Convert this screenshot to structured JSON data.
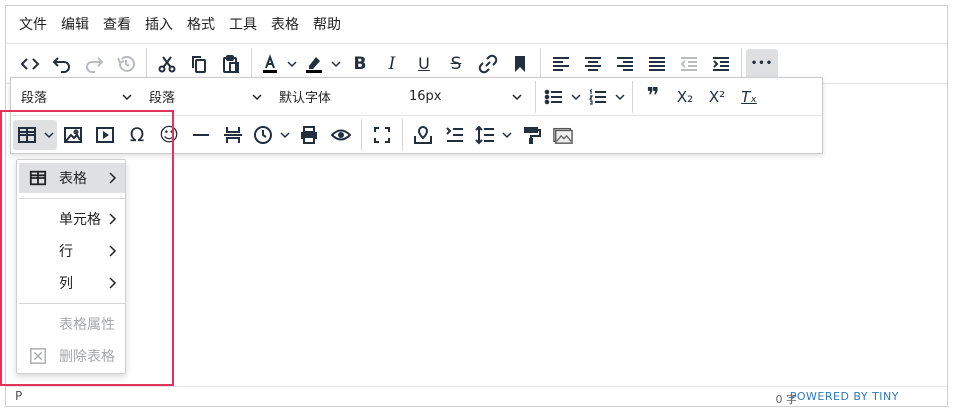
{
  "menubar": {
    "items": [
      "文件",
      "编辑",
      "查看",
      "插入",
      "格式",
      "工具",
      "表格",
      "帮助"
    ]
  },
  "toolbar1": {
    "icons": [
      "source-code-icon",
      "undo-icon",
      "redo-icon",
      "history-icon",
      "cut-icon",
      "copy-icon",
      "paste-icon",
      "text-color-icon",
      "highlight-color-icon",
      "bold-icon",
      "italic-icon",
      "underline-icon",
      "strikethrough-icon",
      "link-icon",
      "bookmark-icon",
      "align-left-icon",
      "align-center-icon",
      "align-right-icon",
      "align-justify-icon",
      "outdent-icon",
      "indent-icon",
      "more-icon"
    ],
    "bold_label": "B",
    "italic_label": "I",
    "underline_label": "U",
    "strike_label": "S",
    "more_label": "•••"
  },
  "toolbar2": {
    "block_format": "段落",
    "paragraph_style": "段落",
    "font_family": "默认字体",
    "font_size": "16px",
    "quote_label": "❞",
    "subscript_label": "X₂",
    "superscript_label": "X²",
    "clear_format_label": "Tₓ"
  },
  "toolbar3": {
    "omega_label": "Ω",
    "emoji_label": "☺"
  },
  "table_menu": {
    "items": [
      {
        "label": "表格",
        "icon": "table-icon",
        "submenu": true,
        "highlighted": true
      },
      {
        "label": "单元格",
        "submenu": true
      },
      {
        "label": "行",
        "submenu": true
      },
      {
        "label": "列",
        "submenu": true
      },
      {
        "label": "表格属性",
        "disabled": true
      },
      {
        "label": "删除表格",
        "icon": "delete-table-icon",
        "disabled": true
      }
    ]
  },
  "statusbar": {
    "path": "P",
    "word_count": "0 字",
    "brand": "POWERED BY TINY"
  },
  "colors": {
    "highlight_border": "#e2345b",
    "active_bg": "#dee0e2",
    "icon": "#222f3e"
  }
}
